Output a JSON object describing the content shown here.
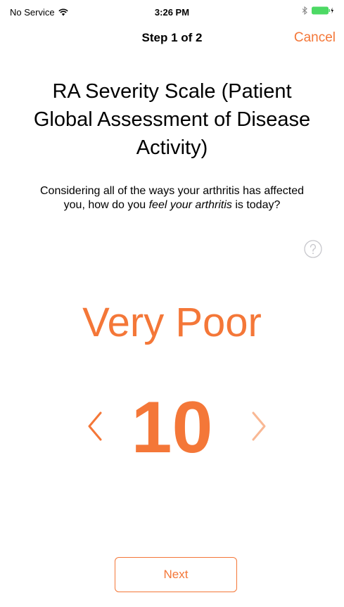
{
  "status_bar": {
    "carrier": "No Service",
    "time": "3:26 PM",
    "wifi_icon": "wifi-icon",
    "bluetooth_icon": "bluetooth-icon",
    "battery_icon": "battery-charging-icon"
  },
  "nav": {
    "title": "Step 1 of 2",
    "cancel_label": "Cancel"
  },
  "question": {
    "title": "RA Severity Scale (Patient Global Assessment of Disease Activity)",
    "text_before": "Considering all of the ways your arthritis has affected you, how do you ",
    "text_emphasis": "feel your arthritis",
    "text_after": " is today?",
    "help_icon": "question-mark-circle-icon"
  },
  "scale": {
    "label": "Very Poor",
    "value": "10",
    "decrement_icon": "chevron-left-icon",
    "increment_icon": "chevron-right-icon"
  },
  "footer": {
    "next_label": "Next"
  },
  "colors": {
    "accent": "#f47738",
    "accent_disabled": "#f9b894",
    "battery": "#4cd964",
    "help_gray": "#c7c7cc"
  }
}
